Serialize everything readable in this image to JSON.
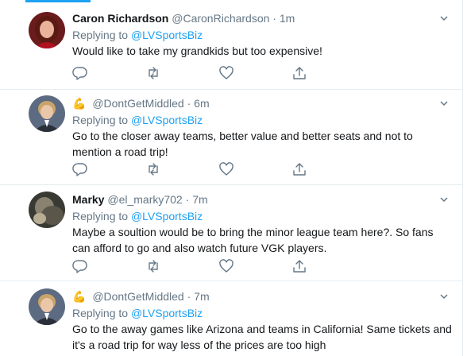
{
  "tweets": [
    {
      "name": "Caron Richardson",
      "handle": "@CaronRichardson",
      "time": "1m",
      "reply_prefix": "Replying to",
      "reply_to": "@LVSportsBiz",
      "text": "Would like to take my grandkids but too expensive!",
      "has_emoji": false
    },
    {
      "name": "",
      "handle": "@DontGetMiddled",
      "time": "6m",
      "reply_prefix": "Replying to",
      "reply_to": "@LVSportsBiz",
      "text": "Go to the closer away teams, better value and better seats and not to mention a road trip!",
      "has_emoji": true
    },
    {
      "name": "Marky",
      "handle": "@el_marky702",
      "time": "7m",
      "reply_prefix": "Replying to",
      "reply_to": "@LVSportsBiz",
      "text": "Maybe a soultion would be to bring the minor league team here?. So fans can afford to go and also watch future VGK players.",
      "has_emoji": false
    },
    {
      "name": "",
      "handle": "@DontGetMiddled",
      "time": "7m",
      "reply_prefix": "Replying to",
      "reply_to": "@LVSportsBiz",
      "text": "Go to the away games like Arizona and teams in California! Same tickets and it's a road trip for way less of the prices are too high",
      "has_emoji": true
    }
  ],
  "separator": "·",
  "emoji": "💪",
  "icons": {
    "reply": "reply-icon",
    "retweet": "retweet-icon",
    "like": "like-icon",
    "share": "share-icon",
    "caret": "chevron-down-icon"
  },
  "colors": {
    "accent": "#1da1f2",
    "secondary_text": "#657786",
    "border": "#e6ecf0",
    "text": "#14171a"
  }
}
